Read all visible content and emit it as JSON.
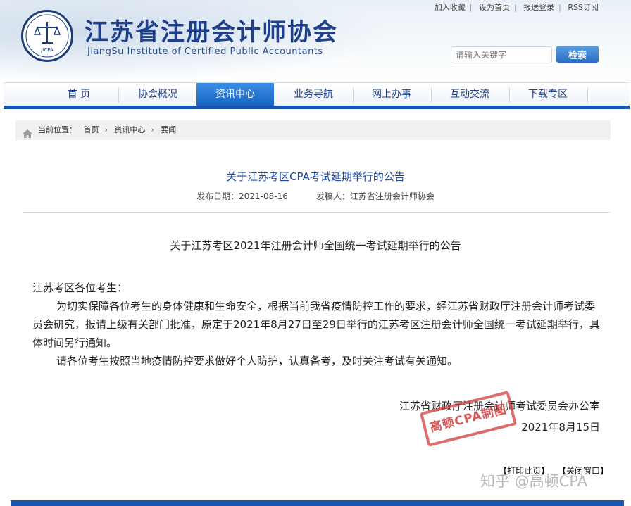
{
  "header": {
    "site_title": "江苏省注册会计师协会",
    "site_subtitle": "JiangSu Institute of Certified Public Accountants",
    "logo_text": "JICPA",
    "top_links": [
      "加入收藏",
      "设为首页",
      "报送登录",
      "RSS订阅"
    ],
    "search_placeholder": "请输入关键字",
    "search_button": "检索",
    "colors": {
      "brand_blue": "#1d3f8c",
      "nav_active": "#1661c4",
      "bar": "#1a55b0"
    }
  },
  "nav": {
    "items": [
      "首 页",
      "协会概况",
      "资讯中心",
      "业务导航",
      "网上办事",
      "互动交流",
      "下载专区"
    ],
    "active": "资讯中心"
  },
  "breadcrumb": {
    "label": "当前位置：",
    "items": [
      "首页",
      "资讯中心",
      "要闻"
    ],
    "icon": "home-icon"
  },
  "article": {
    "title": "关于江苏考区CPA考试延期举行的公告",
    "publish_label": "发布日期：",
    "publish_date": "2021-08-16",
    "author_label": "发稿人：",
    "author": "江苏省注册会计师协会",
    "doc_heading": "关于江苏考区2021年注册会计师全国统一考试延期举行的公告",
    "salutation": "江苏考区各位考生：",
    "paragraph1": "为切实保障各位考生的身体健康和生命安全，根据当前我省疫情防控工作的要求，经江苏省财政厅注册会计师考试委员会研究，报请上级有关部门批准，原定于2021年8月27日至29日举行的江苏考区注册会计师全国统一考试延期举行，具体时间另行通知。",
    "paragraph2": "请各位考生按照当地疫情防控要求做好个人防护，认真备考，及时关注考试有关通知。",
    "signature_org": "江苏省财政厅注册会计师考试委员会办公室",
    "signature_date": "2021年8月15日",
    "stamp_text": "高顿CPA制图"
  },
  "footer": {
    "print": "【打印此页】",
    "close": "【关闭窗口】",
    "watermark": "知乎 @高顿CPA"
  }
}
